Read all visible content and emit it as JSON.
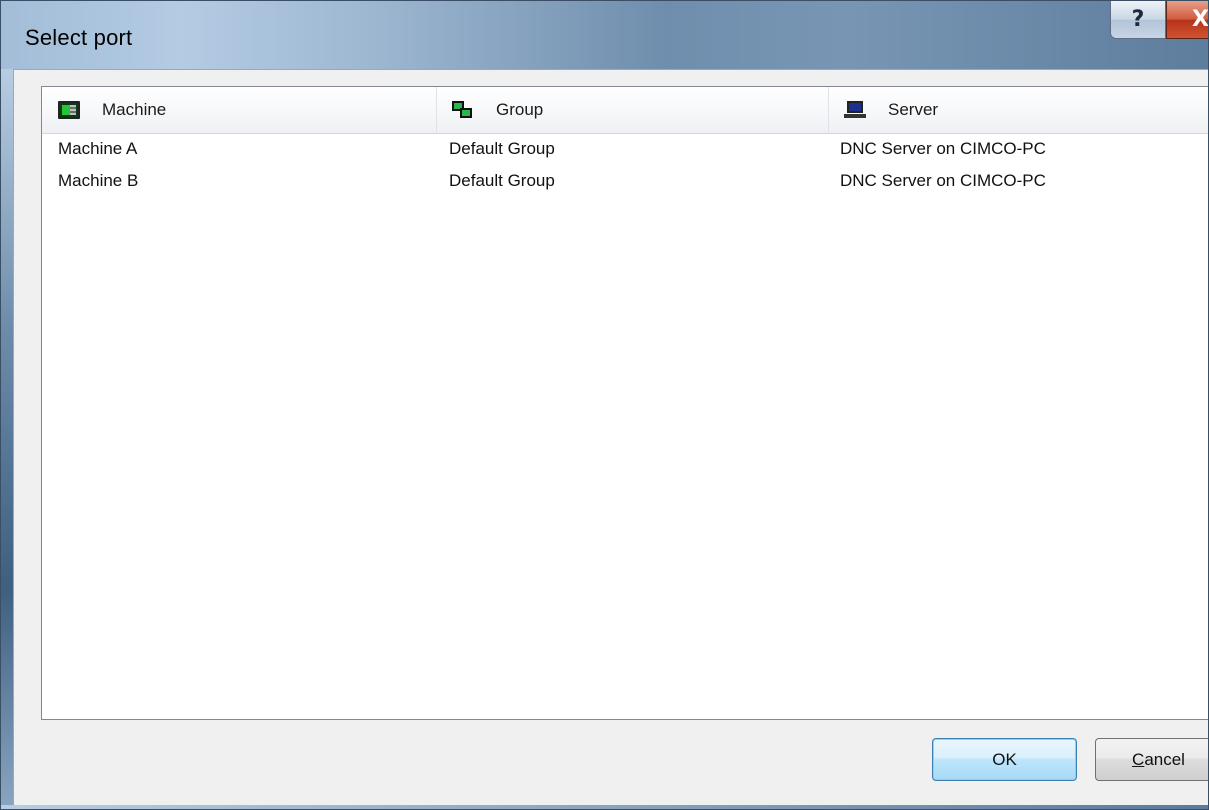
{
  "window": {
    "title": "Select port",
    "help_glyph": "?",
    "close_glyph": "X"
  },
  "listview": {
    "columns": [
      {
        "label": "Machine",
        "icon": "machine-icon"
      },
      {
        "label": "Group",
        "icon": "group-icon"
      },
      {
        "label": "Server",
        "icon": "server-icon"
      }
    ],
    "rows": [
      {
        "machine": "Machine A",
        "group": "Default Group",
        "server": "DNC Server on CIMCO-PC"
      },
      {
        "machine": "Machine B",
        "group": "Default Group",
        "server": "DNC Server on CIMCO-PC"
      }
    ]
  },
  "buttons": {
    "ok_label": "OK",
    "cancel_mnemonic": "C",
    "cancel_rest": "ancel"
  },
  "colors": {
    "ok_border": "#3c7fb1",
    "close_red": "#cf5a3d"
  }
}
